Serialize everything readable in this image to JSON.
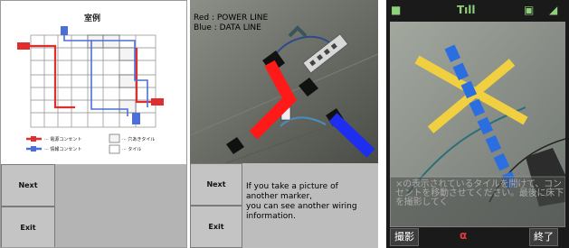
{
  "panel1": {
    "title": "室例",
    "legend": {
      "power": "··· 電源コンセント",
      "data": "··· 情報コンセント",
      "hole": "··· 穴あきタイル",
      "tile": "··· タイル"
    },
    "buttons": {
      "next": "Next",
      "exit": "Exit"
    },
    "colors": {
      "power": "#e02d2d",
      "data": "#4a6fd8",
      "grid": "#8a8a8a"
    }
  },
  "panel2": {
    "caption_red": "Red : POWER LINE",
    "caption_blue": "Blue : DATA LINE",
    "buttons": {
      "next": "Next",
      "exit": "Exit"
    },
    "info_lines": [
      "If you take a picture of",
      "another marker,",
      "you can see another wiring",
      "information."
    ]
  },
  "panel3": {
    "status": {
      "battery": "■",
      "signal": "Tıll",
      "icon1": "▣",
      "icon2": "◢"
    },
    "message": "×の表示されているタイルを開けて、コンセントを移動させてください。最後に床下を撮影してく",
    "softkeys": {
      "left": "撮影",
      "mid": "α",
      "right": "終了"
    }
  }
}
